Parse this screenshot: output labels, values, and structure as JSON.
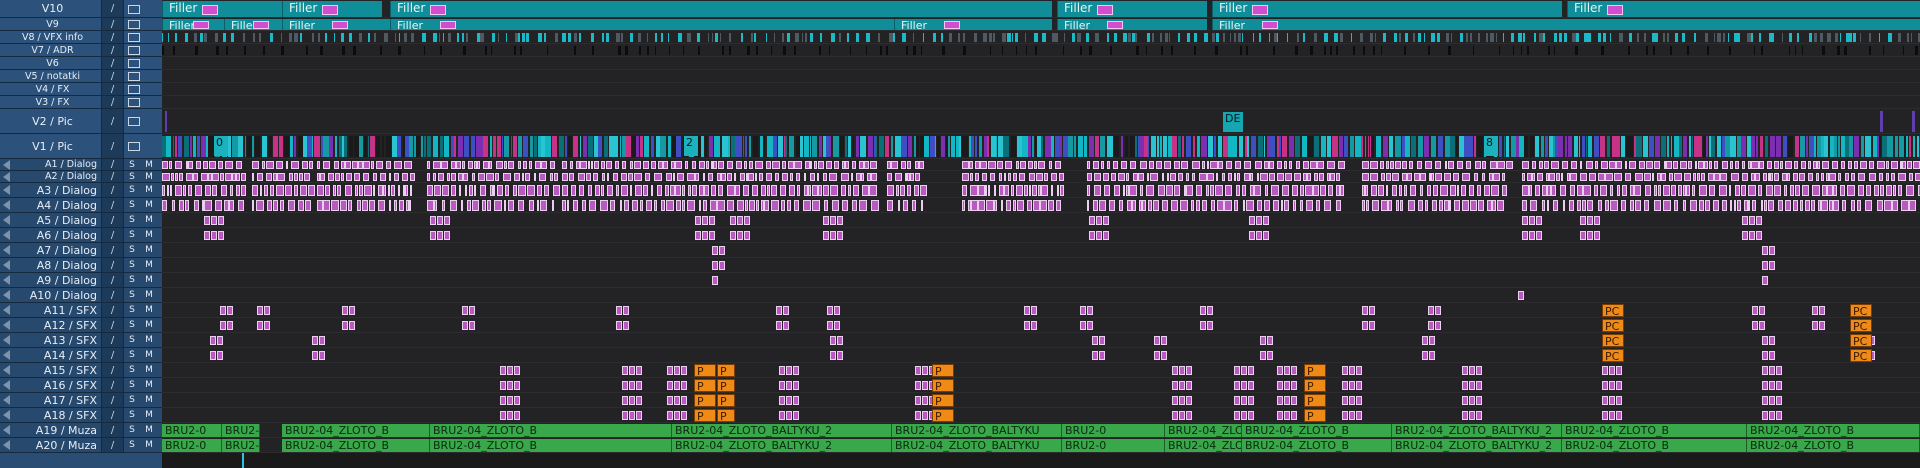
{
  "tracks": [
    {
      "id": "V10",
      "label": "V10",
      "kind": "video"
    },
    {
      "id": "V9",
      "label": "V9",
      "kind": "video"
    },
    {
      "id": "V8",
      "label": "V8 / VFX info",
      "kind": "video"
    },
    {
      "id": "V7",
      "label": "V7 / ADR",
      "kind": "video"
    },
    {
      "id": "V6",
      "label": "V6",
      "kind": "video"
    },
    {
      "id": "V5",
      "label": "V5 / notatki",
      "kind": "video"
    },
    {
      "id": "V4",
      "label": "V4 / FX",
      "kind": "video"
    },
    {
      "id": "V3",
      "label": "V3 / FX",
      "kind": "video"
    },
    {
      "id": "V2",
      "label": "V2 / Pic",
      "kind": "video"
    },
    {
      "id": "V1",
      "label": "V1 / Pic",
      "kind": "video"
    },
    {
      "id": "A1",
      "label": "A1 / Dialog",
      "kind": "audio"
    },
    {
      "id": "A2",
      "label": "A2 / Dialog",
      "kind": "audio"
    },
    {
      "id": "A3",
      "label": "A3 / Dialog",
      "kind": "audio"
    },
    {
      "id": "A4",
      "label": "A4 / Dialog",
      "kind": "audio"
    },
    {
      "id": "A5",
      "label": "A5 / Dialog",
      "kind": "audio"
    },
    {
      "id": "A6",
      "label": "A6 / Dialog",
      "kind": "audio"
    },
    {
      "id": "A7",
      "label": "A7 / Dialog",
      "kind": "audio"
    },
    {
      "id": "A8",
      "label": "A8 / Dialog",
      "kind": "audio"
    },
    {
      "id": "A9",
      "label": "A9 / Dialog",
      "kind": "audio"
    },
    {
      "id": "A10",
      "label": "A10 / Dialog",
      "kind": "audio"
    },
    {
      "id": "A11",
      "label": "A11 / SFX",
      "kind": "audio"
    },
    {
      "id": "A12",
      "label": "A12 / SFX",
      "kind": "audio"
    },
    {
      "id": "A13",
      "label": "A13 / SFX",
      "kind": "audio"
    },
    {
      "id": "A14",
      "label": "A14 / SFX",
      "kind": "audio"
    },
    {
      "id": "A15",
      "label": "A15 / SFX",
      "kind": "audio"
    },
    {
      "id": "A16",
      "label": "A16 / SFX",
      "kind": "audio"
    },
    {
      "id": "A17",
      "label": "A17 / SFX",
      "kind": "audio"
    },
    {
      "id": "A18",
      "label": "A18 / SFX",
      "kind": "audio"
    },
    {
      "id": "A19",
      "label": "A19 / Muza",
      "kind": "audio"
    },
    {
      "id": "A20",
      "label": "A20 / Muza",
      "kind": "audio"
    }
  ],
  "buttons": {
    "solo": "S",
    "mute": "M",
    "target": "/"
  },
  "filler_label": "Filler",
  "pic_labels": [
    "0",
    "2",
    "8",
    "DE"
  ],
  "pc_label": "PC",
  "p_label": "P",
  "muza_clip_labels": [
    "BRU2-04_ZLOTO_BALTYKU_2",
    "BRU2-04_ZLOTO_B",
    "BRU2-04_ZLOTO_BALTYKU",
    "BRU2-0"
  ],
  "colors": {
    "header_bg": "#2a4d73",
    "filler": "#0f8e99",
    "dialog": "#b85ac0",
    "sfx_orange": "#f08a17",
    "muza_green": "#38a84a",
    "playhead": "#2fc1e0"
  }
}
